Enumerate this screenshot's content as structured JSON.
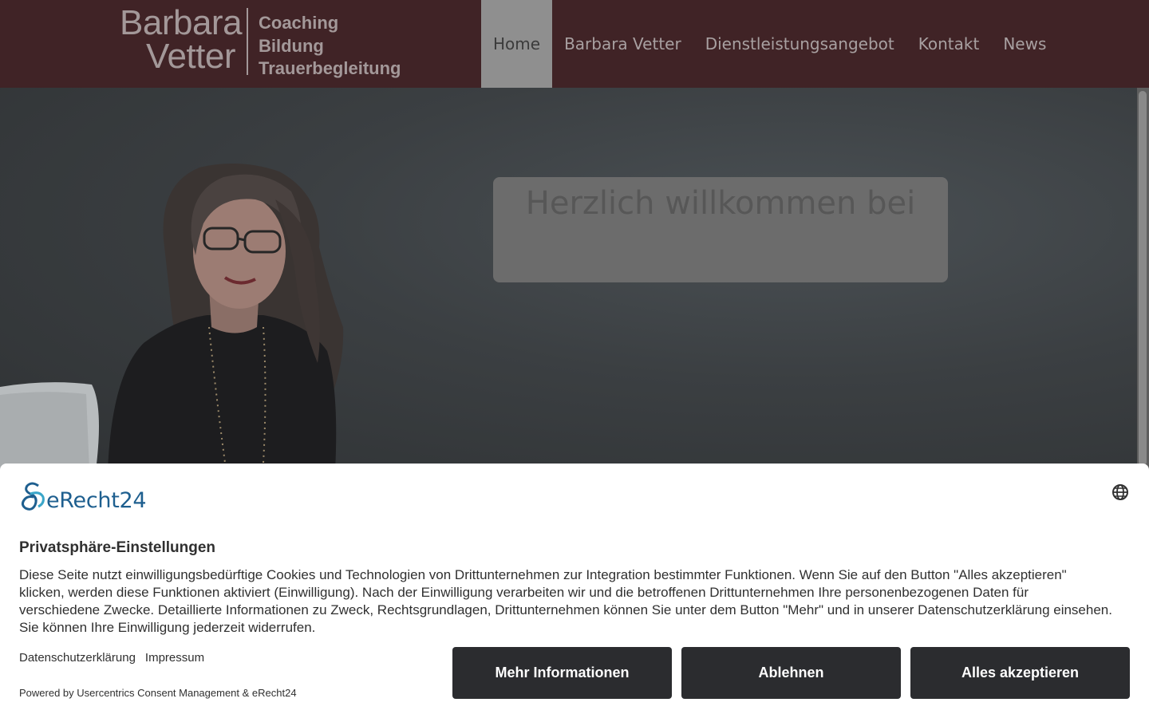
{
  "header": {
    "logo": {
      "name_line1": "Barbara",
      "name_line2": "Vetter",
      "tags": [
        "Coaching",
        "Bildung",
        "Trauerbegleitung"
      ]
    },
    "nav": [
      {
        "label": "Home",
        "active": true
      },
      {
        "label": "Barbara Vetter",
        "active": false
      },
      {
        "label": "Dienstleistungsangebot",
        "active": false
      },
      {
        "label": "Kontakt",
        "active": false
      },
      {
        "label": "News",
        "active": false
      }
    ]
  },
  "hero": {
    "welcome": "Herzlich willkommen bei"
  },
  "consent": {
    "brand": "eRecht24",
    "language_icon": "globe-icon",
    "title": "Privatsphäre-Einstellungen",
    "text": "Diese Seite nutzt einwilligungsbedürftige Cookies und Technologien von Drittunternehmen zur Integration bestimmter Funktionen. Wenn Sie auf den Button \"Alles akzeptieren\" klicken, werden diese Funktionen aktiviert (Einwilligung). Nach der Einwilligung verarbeiten wir und die betroffenen Drittunternehmen Ihre personenbezogenen Daten für verschiedene Zwecke. Detaillierte Informationen zu Zweck, Rechtsgrundlagen, Drittunternehmen können Sie unter dem Button \"Mehr\" und in unserer Datenschutzerklärung einsehen. Sie können Ihre Einwilligung jederzeit widerrufen.",
    "links": [
      "Datenschutzerklärung",
      "Impressum"
    ],
    "powered_by": "Powered by Usercentrics Consent Management & eRecht24",
    "buttons": {
      "more": "Mehr Informationen",
      "deny": "Ablehnen",
      "accept": "Alles akzeptieren"
    }
  },
  "colors": {
    "header_bg": "#402326",
    "nav_active_bg": "#8f8f8f",
    "button_bg": "#2b2c2f",
    "brand_blue": "#1e5f8f"
  }
}
